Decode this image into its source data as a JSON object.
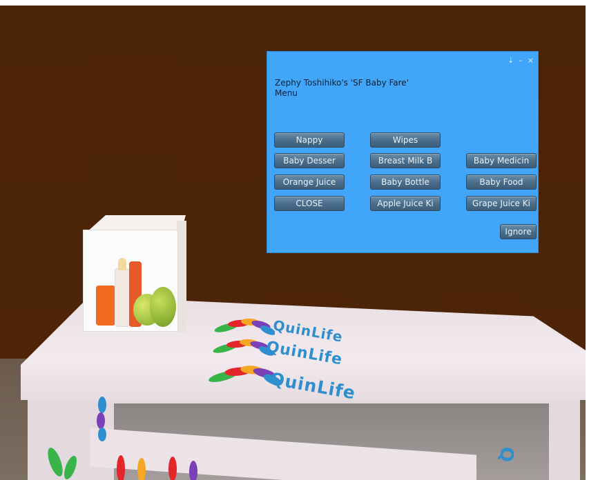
{
  "dialog": {
    "message": "Zephy Toshihiko's 'SF Baby Fare'\nMenu",
    "controls": {
      "pin_icon": "pin-icon",
      "minimize": "–",
      "close": "×"
    },
    "buttons": [
      {
        "label": "Nappy"
      },
      {
        "label": "Wipes"
      },
      {
        "label": "Baby Desser"
      },
      {
        "label": "Breast Milk B"
      },
      {
        "label": "Baby Medicin"
      },
      {
        "label": "Orange Juice"
      },
      {
        "label": "Baby Bottle"
      },
      {
        "label": "Baby Food"
      },
      {
        "label": "CLOSE"
      },
      {
        "label": "Apple Juice Ki"
      },
      {
        "label": "Grape Juice Ki"
      }
    ],
    "ignore_label": "Ignore",
    "colors": {
      "background": "#41a6f9",
      "button": "#486c89"
    }
  },
  "scene": {
    "logo_text": "QuinLife"
  }
}
